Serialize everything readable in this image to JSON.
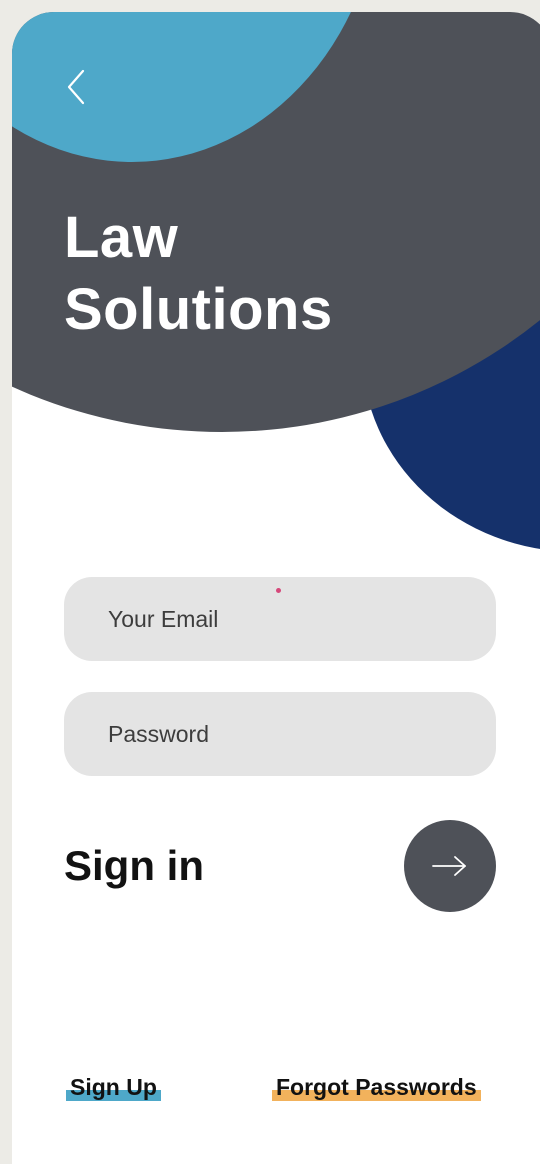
{
  "header": {
    "title_line1": "Law",
    "title_line2": "Solutions"
  },
  "form": {
    "email_placeholder": "Your Email",
    "password_placeholder": "Password",
    "signin_label": "Sign in"
  },
  "links": {
    "signup": "Sign Up",
    "forgot": "Forgot Passwords"
  },
  "icons": {
    "back": "chevron-left-icon",
    "submit": "arrow-right-icon"
  },
  "colors": {
    "background": "#ecebe6",
    "hero_dark": "#4e5158",
    "hero_light_blue": "#4ea8c9",
    "hero_navy": "#15316b",
    "field_bg": "#e4e4e4",
    "signup_highlight": "#4ea8c9",
    "forgot_highlight": "#f2b25c"
  }
}
